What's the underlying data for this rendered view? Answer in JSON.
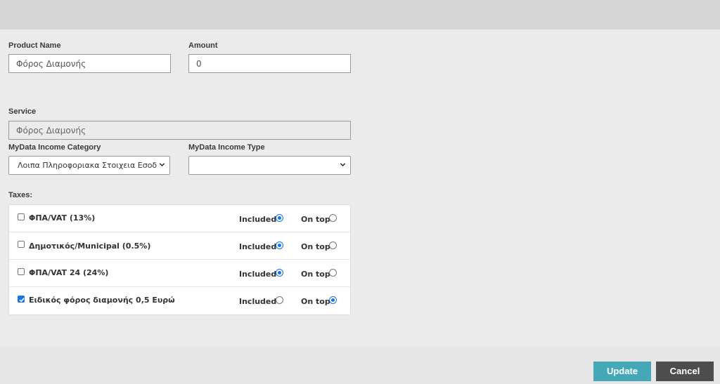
{
  "form": {
    "product_name_label": "Product Name",
    "product_name_value": "Φόρος Διαμονής",
    "amount_label": "Amount",
    "amount_value": "0",
    "service_label": "Service",
    "service_value": "Φόρος Διαμονής",
    "income_category_label": "MyData Income Category",
    "income_category_value": "Λοιπα Πληροφοριακα Στοιχεια Εσοδ",
    "income_type_label": "MyData Income Type",
    "income_type_value": "",
    "taxes_label": "Taxes:"
  },
  "taxes": [
    {
      "name": "ΦΠΑ/VAT (13%)",
      "checked": false,
      "included_label": "Included",
      "ontop_label": "On top",
      "mode": "included"
    },
    {
      "name": "Δημοτικός/Municipal (0.5%)",
      "checked": false,
      "included_label": "Included",
      "ontop_label": "On top",
      "mode": "included"
    },
    {
      "name": "ΦΠΑ/VAT 24 (24%)",
      "checked": false,
      "included_label": "Included",
      "ontop_label": "On top",
      "mode": "included"
    },
    {
      "name": "Ειδικός φόρος διαμονής 0,5 Ευρώ",
      "checked": true,
      "included_label": "Included",
      "ontop_label": "On top",
      "mode": "ontop"
    }
  ],
  "actions": {
    "update_label": "Update",
    "cancel_label": "Cancel"
  },
  "colors": {
    "accent": "#1a73e8",
    "update_button": "#45a8b7",
    "cancel_button": "#4d4d4d"
  }
}
